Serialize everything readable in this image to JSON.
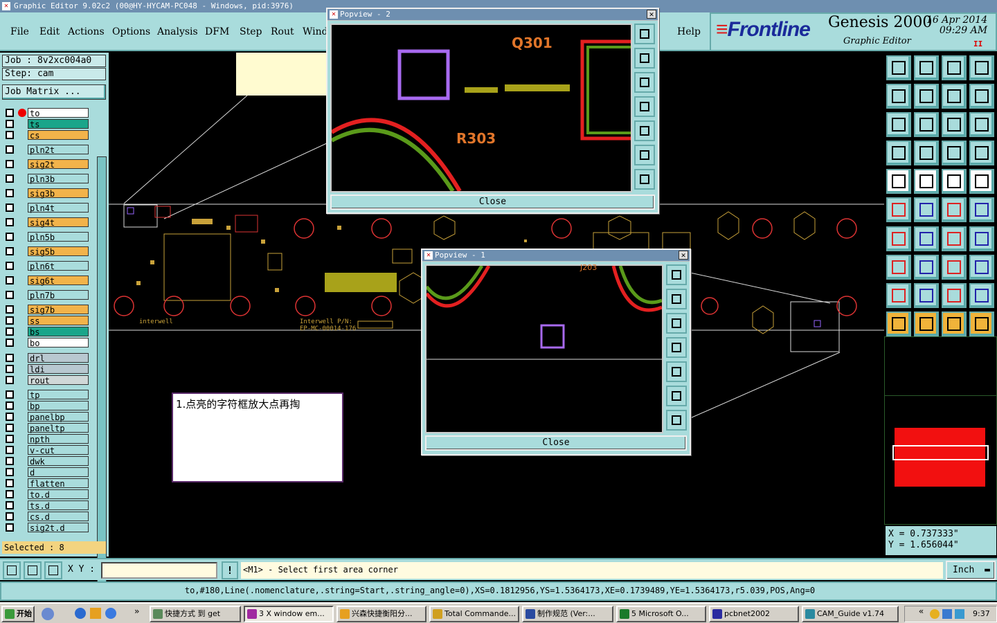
{
  "window": {
    "title": "Graphic Editor 9.02c2 (00@HY-HYCAM-PC048 - Windows, pid:3976)"
  },
  "menu": [
    "File",
    "Edit",
    "Actions",
    "Options",
    "Analysis",
    "DFM",
    "Step",
    "Rout",
    "Wind",
    "Help"
  ],
  "brand": {
    "logo": "Frontline",
    "product": "Genesis 2000",
    "subtitle": "Graphic Editor",
    "date": "16 Apr 2014",
    "time": "09:29 AM",
    "pause": "II"
  },
  "job": {
    "job": "Job : 8v2xc004a0",
    "step": "Step: cam",
    "matrix_button": "Job Matrix ..."
  },
  "layers": [
    {
      "name": "to",
      "color": "#ffffff",
      "group": 1
    },
    {
      "name": "ts",
      "color": "#1aa58a",
      "group": 1
    },
    {
      "name": "cs",
      "color": "#f2b34a",
      "group": 1
    },
    {
      "name": "pln2t",
      "color": "#a9dcdc",
      "group": 2
    },
    {
      "name": "sig2t",
      "color": "#f2b34a",
      "group": 2
    },
    {
      "name": "pln3b",
      "color": "#a9dcdc",
      "group": 2
    },
    {
      "name": "sig3b",
      "color": "#f2b34a",
      "group": 2
    },
    {
      "name": "pln4t",
      "color": "#a9dcdc",
      "group": 2
    },
    {
      "name": "sig4t",
      "color": "#f2b34a",
      "group": 2
    },
    {
      "name": "pln5b",
      "color": "#a9dcdc",
      "group": 2
    },
    {
      "name": "sig5b",
      "color": "#f2b34a",
      "group": 2
    },
    {
      "name": "pln6t",
      "color": "#a9dcdc",
      "group": 2
    },
    {
      "name": "sig6t",
      "color": "#f2b34a",
      "group": 2
    },
    {
      "name": "pln7b",
      "color": "#a9dcdc",
      "group": 2
    },
    {
      "name": "sig7b",
      "color": "#f2b34a",
      "group": 3
    },
    {
      "name": "ss",
      "color": "#f2b34a",
      "group": 3
    },
    {
      "name": "bs",
      "color": "#1aa58a",
      "group": 3
    },
    {
      "name": "bo",
      "color": "#ffffff",
      "group": 3
    },
    {
      "name": "drl",
      "color": "#b8c8d0",
      "group": 4
    },
    {
      "name": "ldi",
      "color": "#b8c8d0",
      "group": 4
    },
    {
      "name": "rout",
      "color": "#d0d8d8",
      "group": 4
    },
    {
      "name": "tp",
      "color": "#a9dcdc",
      "group": 5
    },
    {
      "name": "bp",
      "color": "#a9dcdc",
      "group": 5
    },
    {
      "name": "panelbp",
      "color": "#a9dcdc",
      "group": 5
    },
    {
      "name": "paneltp",
      "color": "#a9dcdc",
      "group": 5
    },
    {
      "name": "npth",
      "color": "#a9dcdc",
      "group": 5
    },
    {
      "name": "v-cut",
      "color": "#a9dcdc",
      "group": 5
    },
    {
      "name": "dwk",
      "color": "#a9dcdc",
      "group": 5
    },
    {
      "name": "d",
      "color": "#a9dcdc",
      "group": 5
    },
    {
      "name": "flatten",
      "color": "#a9dcdc",
      "group": 5
    },
    {
      "name": "to.d",
      "color": "#a9dcdc",
      "group": 5
    },
    {
      "name": "ts.d",
      "color": "#a9dcdc",
      "group": 5
    },
    {
      "name": "cs.d",
      "color": "#a9dcdc",
      "group": 5
    },
    {
      "name": "sig2t.d",
      "color": "#a9dcdc",
      "group": 5
    }
  ],
  "selected": "Selected : 8",
  "popview2": {
    "title": "Popview - 2",
    "close": "Close",
    "labels": [
      "Q301",
      "R303"
    ]
  },
  "popview1": {
    "title": "Popview - 1",
    "close": "Close",
    "labels": [
      "J203"
    ]
  },
  "note": "1.点亮的字符框放大点再掏",
  "board_text": [
    "Interwell P/N:",
    "EP-MC-00014-176",
    "interwell"
  ],
  "coords": {
    "x": "X = 0.737333\"",
    "y": "Y = 1.656044\""
  },
  "command": {
    "xy_label": "X Y :",
    "xy_value": "",
    "prompt": "<M1> - Select first area corner",
    "units": "Inch"
  },
  "status": "to,#180,Line(.nomenclature,.string=Start,.string_angle=0),XS=0.1812956,YS=1.5364173,XE=0.1739489,YE=1.5364173,r5.039,POS,Ang=0",
  "taskbar": {
    "start": "开始",
    "tasks": [
      "快捷方式 到 get",
      "3 X window em...",
      "兴森快捷衡阳分...",
      "Total Commande...",
      "制作规范 (Ver:...",
      "5 Microsoft O...",
      "pcbnet2002",
      "CAM_Guide v1.74"
    ],
    "clock": "9:37"
  }
}
